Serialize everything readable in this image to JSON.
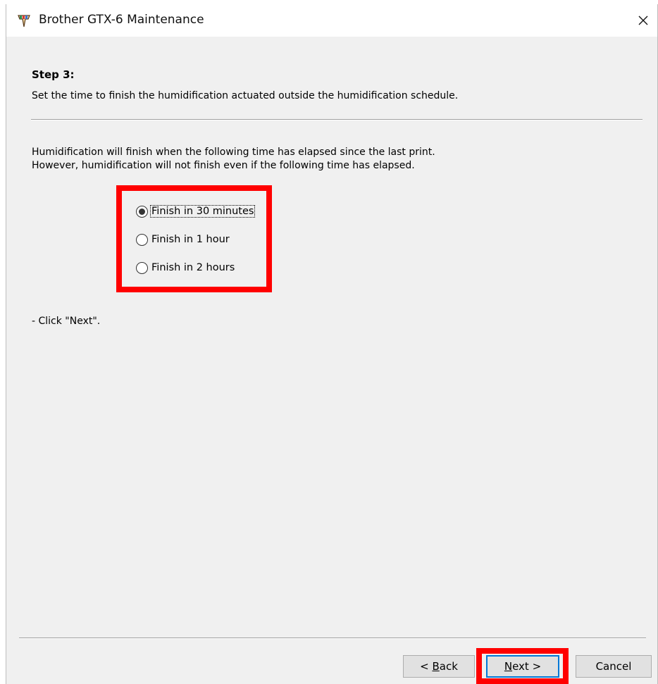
{
  "window": {
    "title": "Brother GTX-6 Maintenance",
    "close_glyph": "✕"
  },
  "step": {
    "title": "Step 3:",
    "description": "Set the time to finish the humidification actuated outside the humidification schedule."
  },
  "info": {
    "line1": "Humidification will finish when the following time has elapsed since the last print.",
    "line2": "However, humidification will not finish even if the following time has elapsed."
  },
  "options": [
    {
      "label": "Finish in 30 minutes",
      "selected": true
    },
    {
      "label": "Finish in 1 hour",
      "selected": false
    },
    {
      "label": "Finish in 2 hours",
      "selected": false
    }
  ],
  "hint": "- Click \"Next\".",
  "buttons": {
    "back": {
      "mnemonic": "B",
      "rest": "ack",
      "prefix": "< "
    },
    "next": {
      "mnemonic": "N",
      "rest": "ext >",
      "prefix": ""
    },
    "cancel": "Cancel"
  },
  "colors": {
    "highlight": "#ff0000",
    "dialog_bg": "#f0f0f0",
    "button_bg": "#e1e1e1",
    "focus_border": "#0078d7"
  }
}
